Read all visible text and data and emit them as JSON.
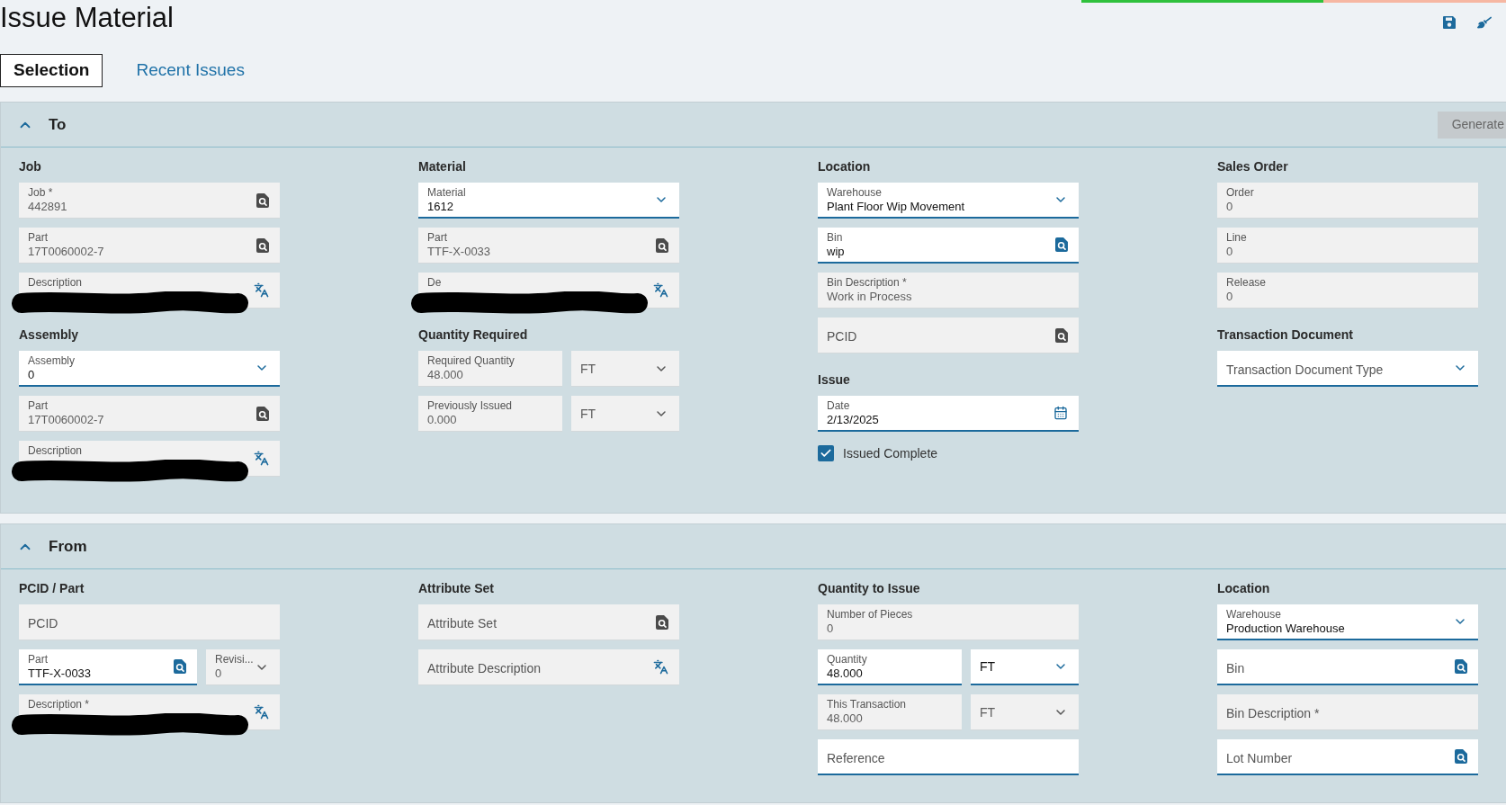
{
  "header": {
    "title": "Issue Material",
    "progress": {
      "level": 0.57
    }
  },
  "tabs": [
    {
      "label": "Selection",
      "selected": true
    },
    {
      "label": "Recent Issues",
      "selected": false
    }
  ],
  "sections": [
    {
      "title": "To",
      "expanded": true,
      "action": {
        "label": "Generate",
        "disabled": true
      },
      "columns": [
        [
          {
            "heading": "Job",
            "rows": [
              [
                {
                  "kind": "lookup",
                  "label": "Job *",
                  "value": "442891",
                  "editable": false
                }
              ],
              [
                {
                  "kind": "lookup",
                  "label": "Part",
                  "value": "17T0060002-7",
                  "editable": false
                }
              ],
              [
                {
                  "kind": "translate",
                  "label": "Description",
                  "editable": false,
                  "redacted": true
                }
              ]
            ]
          },
          {
            "heading": "Assembly",
            "rows": [
              [
                {
                  "kind": "dropdown",
                  "label": "Assembly",
                  "value": "0",
                  "editable": true
                }
              ],
              [
                {
                  "kind": "lookup",
                  "label": "Part",
                  "value": "17T0060002-7",
                  "editable": false
                }
              ],
              [
                {
                  "kind": "translate",
                  "label": "Description",
                  "editable": false,
                  "redacted": true
                }
              ]
            ]
          }
        ],
        [
          {
            "heading": "Material",
            "rows": [
              [
                {
                  "kind": "dropdown",
                  "label": "Material",
                  "value": "1612",
                  "editable": true
                }
              ],
              [
                {
                  "kind": "lookup",
                  "label": "Part",
                  "value": "TTF-X-0033",
                  "editable": false
                }
              ],
              [
                {
                  "kind": "translate",
                  "label": "De",
                  "editable": false,
                  "redacted": true
                }
              ]
            ]
          },
          {
            "heading": "Quantity Required",
            "rows": [
              [
                {
                  "kind": "text",
                  "label": "Required Quantity",
                  "value": "48.000",
                  "editable": false
                },
                {
                  "kind": "dropdown",
                  "value": "FT",
                  "editable": false
                }
              ],
              [
                {
                  "kind": "text",
                  "label": "Previously Issued",
                  "value": "0.000",
                  "editable": false
                },
                {
                  "kind": "dropdown",
                  "value": "FT",
                  "editable": false
                }
              ]
            ]
          }
        ],
        [
          {
            "heading": "Location",
            "rows": [
              [
                {
                  "kind": "dropdown",
                  "label": "Warehouse",
                  "value": "Plant Floor Wip Movement",
                  "editable": true
                }
              ],
              [
                {
                  "kind": "lookup",
                  "label": "Bin",
                  "value": "wip",
                  "editable": true
                }
              ],
              [
                {
                  "kind": "text",
                  "label": "Bin Description *",
                  "value": "Work in Process",
                  "editable": false
                }
              ],
              [
                {
                  "kind": "lookup",
                  "placeholder": "PCID",
                  "editable": false
                }
              ]
            ]
          },
          {
            "heading": "Issue",
            "rows": [
              [
                {
                  "kind": "date",
                  "label": "Date",
                  "value": "2/13/2025",
                  "editable": true
                }
              ],
              [
                {
                  "kind": "checkbox",
                  "label": "Issued Complete",
                  "checked": true
                }
              ]
            ]
          }
        ],
        [
          {
            "heading": "Sales Order",
            "rows": [
              [
                {
                  "kind": "text",
                  "label": "Order",
                  "value": "0",
                  "editable": false
                }
              ],
              [
                {
                  "kind": "text",
                  "label": "Line",
                  "value": "0",
                  "editable": false
                }
              ],
              [
                {
                  "kind": "text",
                  "label": "Release",
                  "value": "0",
                  "editable": false
                }
              ]
            ]
          },
          {
            "heading": "Transaction Document",
            "rows": [
              [
                {
                  "kind": "dropdown",
                  "placeholder": "Transaction Document Type",
                  "editable": true
                }
              ]
            ]
          }
        ]
      ]
    },
    {
      "title": "From",
      "expanded": true,
      "columns": [
        [
          {
            "heading": "PCID / Part",
            "rows": [
              [
                {
                  "kind": "text",
                  "placeholder": "PCID",
                  "editable": false
                }
              ],
              [
                {
                  "kind": "lookup",
                  "label": "Part",
                  "value": "TTF-X-0033",
                  "editable": true
                },
                {
                  "kind": "dropdown",
                  "label": "Revisi...",
                  "value": "0",
                  "editable": false
                }
              ],
              [
                {
                  "kind": "translate",
                  "label": "Description *",
                  "editable": false,
                  "redacted": true
                }
              ]
            ]
          }
        ],
        [
          {
            "heading": "Attribute Set",
            "rows": [
              [
                {
                  "kind": "lookup",
                  "placeholder": "Attribute Set",
                  "editable": false
                }
              ],
              [
                {
                  "kind": "translate",
                  "placeholder": "Attribute Description",
                  "editable": false
                }
              ]
            ]
          }
        ],
        [
          {
            "heading": "Quantity to Issue",
            "rows": [
              [
                {
                  "kind": "text",
                  "label": "Number of Pieces",
                  "value": "0",
                  "editable": false
                }
              ],
              [
                {
                  "kind": "text",
                  "label": "Quantity",
                  "value": "48.000",
                  "editable": true
                },
                {
                  "kind": "dropdown",
                  "value": "FT",
                  "editable": true
                }
              ],
              [
                {
                  "kind": "text",
                  "label": "This Transaction",
                  "value": "48.000",
                  "editable": false
                },
                {
                  "kind": "dropdown",
                  "value": "FT",
                  "editable": false
                }
              ],
              [
                {
                  "kind": "text",
                  "placeholder": "Reference",
                  "editable": true
                }
              ]
            ]
          }
        ],
        [
          {
            "heading": "Location",
            "rows": [
              [
                {
                  "kind": "dropdown",
                  "label": "Warehouse",
                  "value": "Production Warehouse",
                  "editable": true
                }
              ],
              [
                {
                  "kind": "lookup",
                  "placeholder": "Bin",
                  "editable": true
                }
              ],
              [
                {
                  "kind": "text",
                  "placeholder": "Bin Description *",
                  "editable": false
                }
              ],
              [
                {
                  "kind": "lookup",
                  "placeholder": "Lot Number",
                  "editable": true
                }
              ]
            ]
          }
        ]
      ]
    }
  ]
}
